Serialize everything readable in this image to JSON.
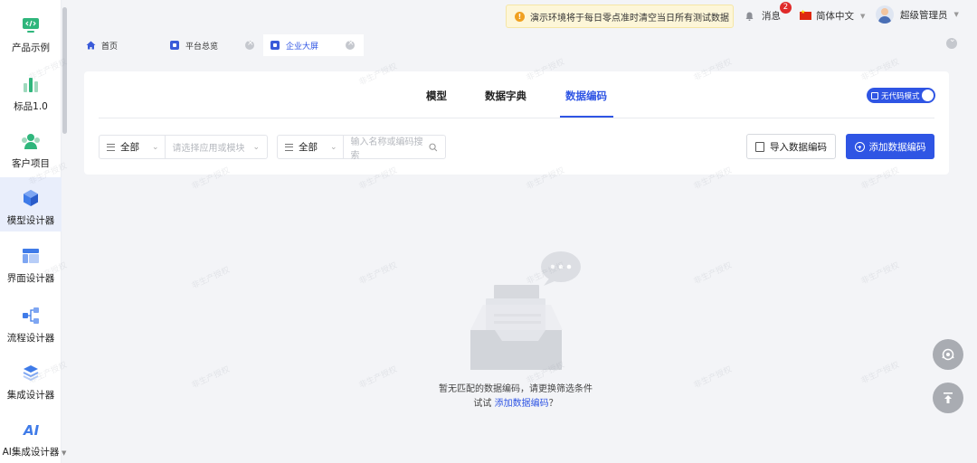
{
  "sidebar": {
    "items": [
      {
        "label": "产品示例",
        "icon": "code-monitor-icon",
        "active": false
      },
      {
        "label": "标品1.0",
        "icon": "bar-chart-icon",
        "active": false
      },
      {
        "label": "客户项目",
        "icon": "users-icon",
        "active": false
      },
      {
        "label": "模型设计器",
        "icon": "cube-icon",
        "active": true
      },
      {
        "label": "界面设计器",
        "icon": "layout-icon",
        "active": false
      },
      {
        "label": "流程设计器",
        "icon": "flow-icon",
        "active": false
      },
      {
        "label": "集成设计器",
        "icon": "layers-icon",
        "active": false
      },
      {
        "label": "AI集成设计器",
        "icon": "ai-icon",
        "active": false
      }
    ]
  },
  "topbar": {
    "notice": "演示环境将于每日零点准时清空当日所有测试数据",
    "messages_label": "消息",
    "messages_count": "2",
    "language": "简体中文",
    "user_name": "超级管理员"
  },
  "tabs": [
    {
      "label": "首页",
      "active": false
    },
    {
      "label": "平台总览",
      "active": false
    },
    {
      "label": "企业大屏",
      "active": true
    }
  ],
  "subtabs": [
    "模型",
    "数据字典",
    "数据编码"
  ],
  "active_subtab": "数据编码",
  "nocode_toggle": {
    "label": "无代码模式",
    "on": true
  },
  "filters": {
    "app_filter_value": "全部",
    "app_placeholder": "请选择应用或模块",
    "search_filter_value": "全部",
    "search_placeholder": "输入名称或编码搜索"
  },
  "actions": {
    "import_label": "导入数据编码",
    "add_label": "添加数据编码"
  },
  "empty_state": {
    "line1": "暂无匹配的数据编码，请更换筛选条件",
    "line2_prefix": "试试",
    "link": "添加数据编码",
    "line2_suffix": "？"
  },
  "watermark": "非生产授权",
  "colors": {
    "accent": "#2f55e4",
    "sidebar_active_bg": "#e9eefb",
    "notice_bg": "#fdf6d8",
    "badge": "#e02a2a"
  }
}
